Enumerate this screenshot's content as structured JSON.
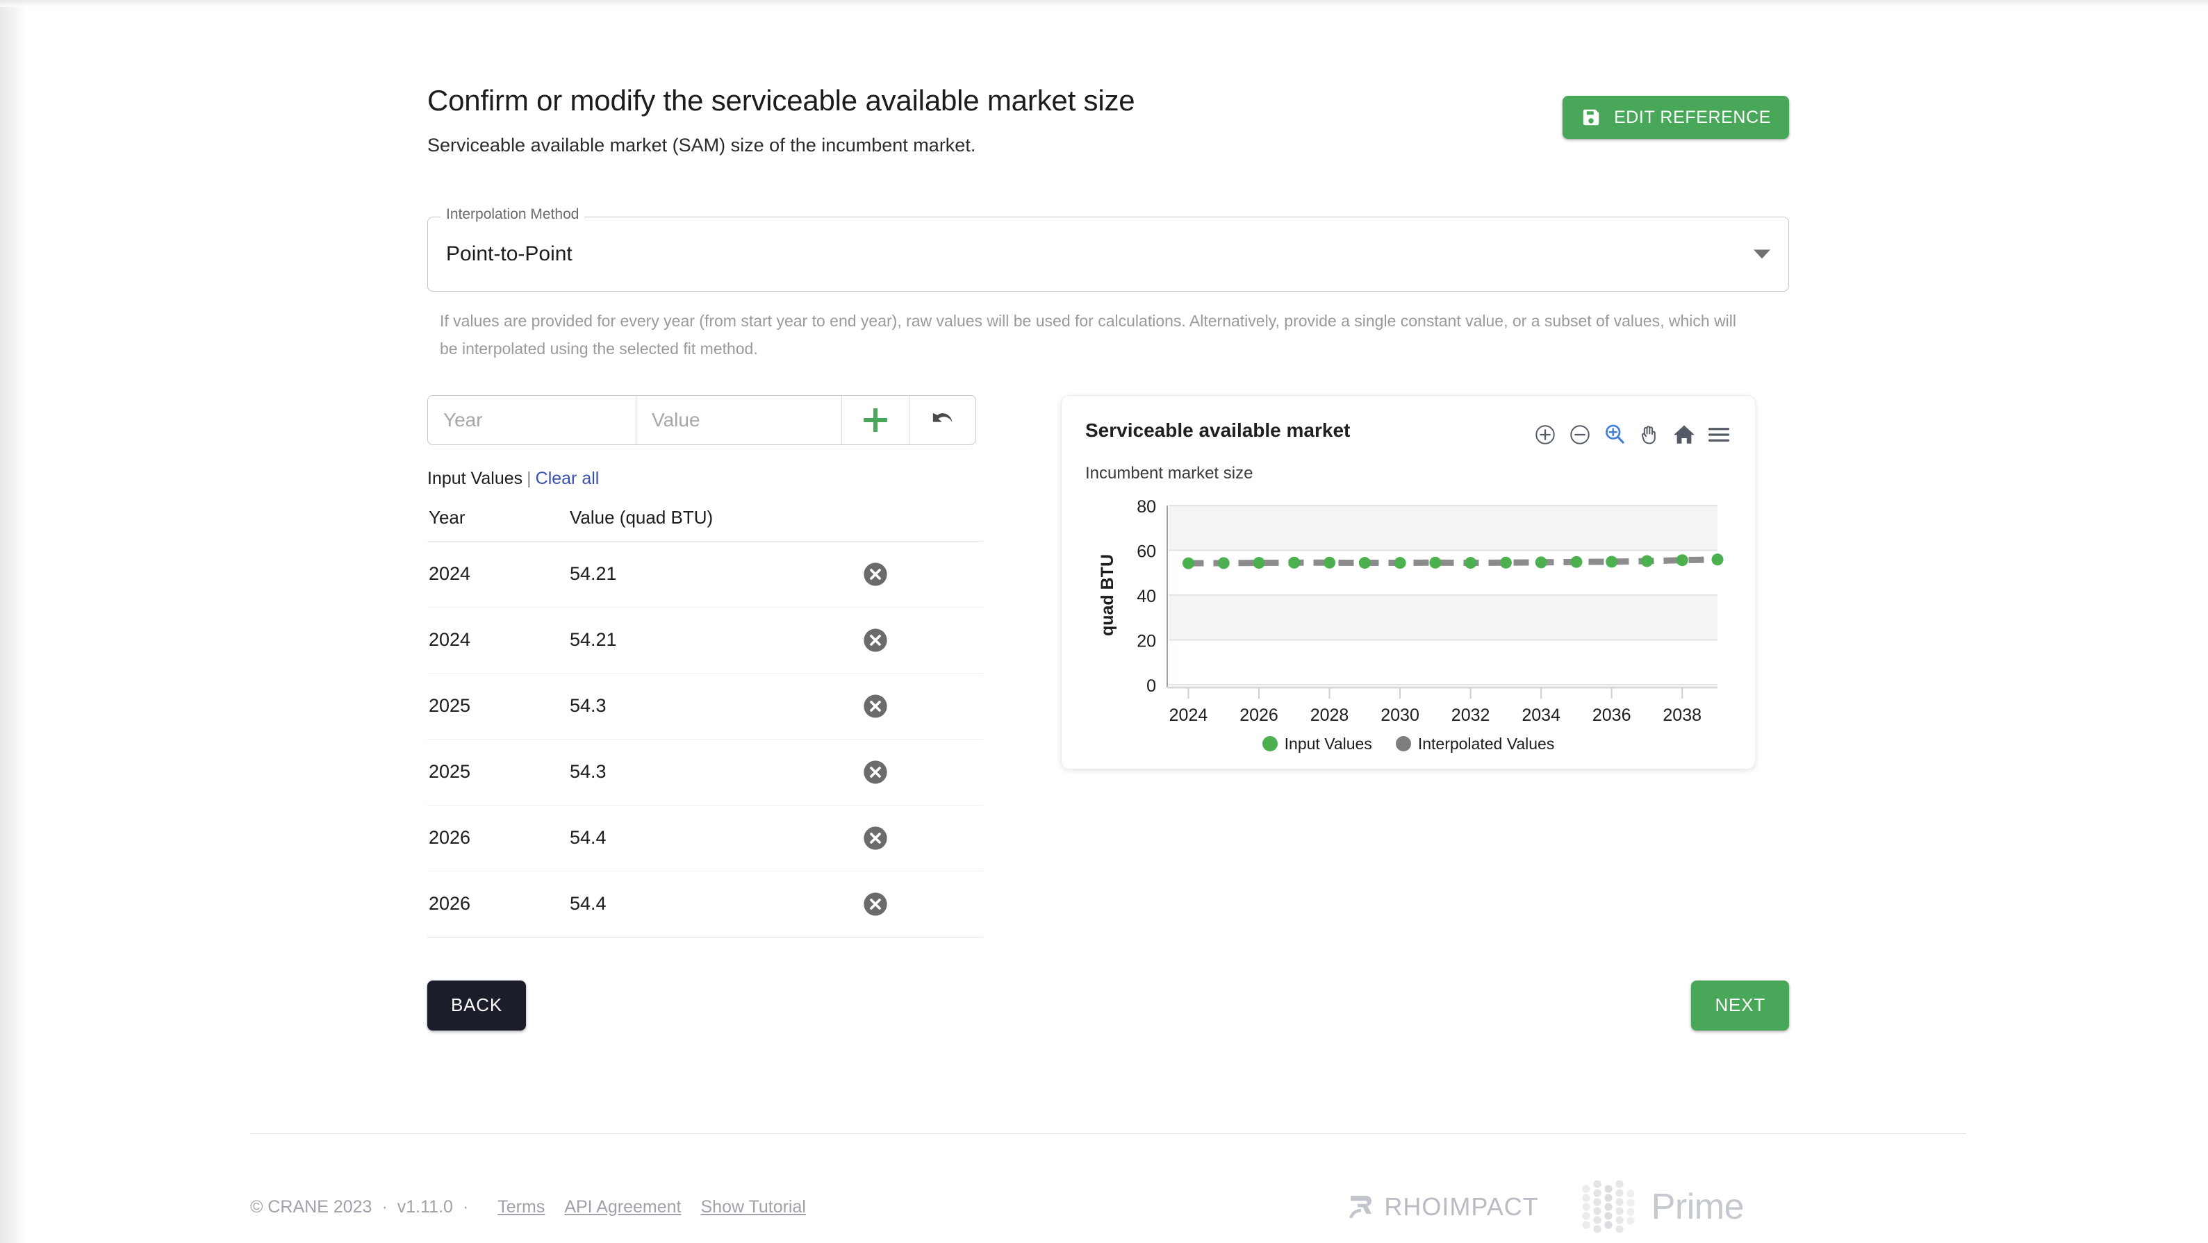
{
  "header": {
    "title": "Confirm or modify the serviceable available market size",
    "subtitle": "Serviceable available market (SAM) size of the incumbent market.",
    "edit_reference_label": "EDIT REFERENCE",
    "accent_green": "#49a75a"
  },
  "interpolation": {
    "legend": "Interpolation Method",
    "selected": "Point-to-Point",
    "helper": "If values are provided for every year (from start year to end year), raw values will be used for calculations. Alternatively, provide a single constant value, or a subset of values, which will be interpolated using the selected fit method."
  },
  "add_row": {
    "year_placeholder": "Year",
    "value_placeholder": "Value",
    "year_value": "",
    "value_value": "",
    "add_title": "Add",
    "undo_title": "Undo"
  },
  "input_values": {
    "label": "Input Values",
    "separator": "|",
    "clear_all": "Clear all",
    "columns": [
      "Year",
      "Value (quad BTU)"
    ],
    "rows": [
      {
        "year": "2024",
        "value": "54.21"
      },
      {
        "year": "2024",
        "value": "54.21"
      },
      {
        "year": "2025",
        "value": "54.3"
      },
      {
        "year": "2025",
        "value": "54.3"
      },
      {
        "year": "2026",
        "value": "54.4"
      },
      {
        "year": "2026",
        "value": "54.4"
      }
    ]
  },
  "chart_card": {
    "title": "Serviceable available market",
    "subtitle": "Incumbent market size",
    "tools": [
      {
        "name": "zoom-in-icon",
        "title": "Zoom in"
      },
      {
        "name": "zoom-out-icon",
        "title": "Zoom out"
      },
      {
        "name": "zoom-select-icon",
        "title": "Box zoom",
        "active": true
      },
      {
        "name": "pan-icon",
        "title": "Pan"
      },
      {
        "name": "home-icon",
        "title": "Reset"
      },
      {
        "name": "menu-icon",
        "title": "Menu"
      }
    ]
  },
  "chart_data": {
    "type": "line",
    "title": "Serviceable available market",
    "subtitle": "Incumbent market size",
    "xlabel": "",
    "ylabel": "quad BTU",
    "xlim": [
      2023.4,
      2039.0
    ],
    "ylim": [
      0,
      80
    ],
    "yticks": [
      0,
      20,
      40,
      60,
      80
    ],
    "xticks": [
      2024,
      2026,
      2028,
      2030,
      2032,
      2034,
      2036,
      2038
    ],
    "grid": true,
    "legend_position": "bottom",
    "series": [
      {
        "name": "Interpolated Values",
        "color": "#8c8c8c",
        "style": "dashed-line",
        "x": [
          2024,
          2025,
          2026,
          2027,
          2028,
          2029,
          2030,
          2031,
          2032,
          2033,
          2034,
          2035,
          2036,
          2037,
          2038,
          2039
        ],
        "values": [
          54.21,
          54.3,
          54.4,
          54.5,
          54.5,
          54.4,
          54.4,
          54.5,
          54.4,
          54.5,
          54.6,
          54.8,
          54.9,
          55.2,
          55.6,
          55.9
        ]
      },
      {
        "name": "Input Values",
        "color": "#4caf50",
        "style": "markers",
        "x": [
          2024,
          2025,
          2026,
          2027,
          2028,
          2029,
          2030,
          2031,
          2032,
          2033,
          2034,
          2035,
          2036,
          2037,
          2038,
          2039
        ],
        "values": [
          54.21,
          54.3,
          54.4,
          54.5,
          54.5,
          54.4,
          54.4,
          54.5,
          54.4,
          54.5,
          54.6,
          54.8,
          54.9,
          55.2,
          55.6,
          55.9
        ]
      }
    ],
    "legend": [
      "Input Values",
      "Interpolated Values"
    ]
  },
  "nav": {
    "back_label": "BACK",
    "next_label": "NEXT"
  },
  "footer": {
    "copyright": "© CRANE 2023",
    "dot1": "·",
    "version": "v1.11.0",
    "dot2": "·",
    "links": [
      "Terms",
      "API Agreement",
      "Show Tutorial"
    ],
    "logo_rho": "RHOIMPACT",
    "logo_prime": "Prime"
  }
}
